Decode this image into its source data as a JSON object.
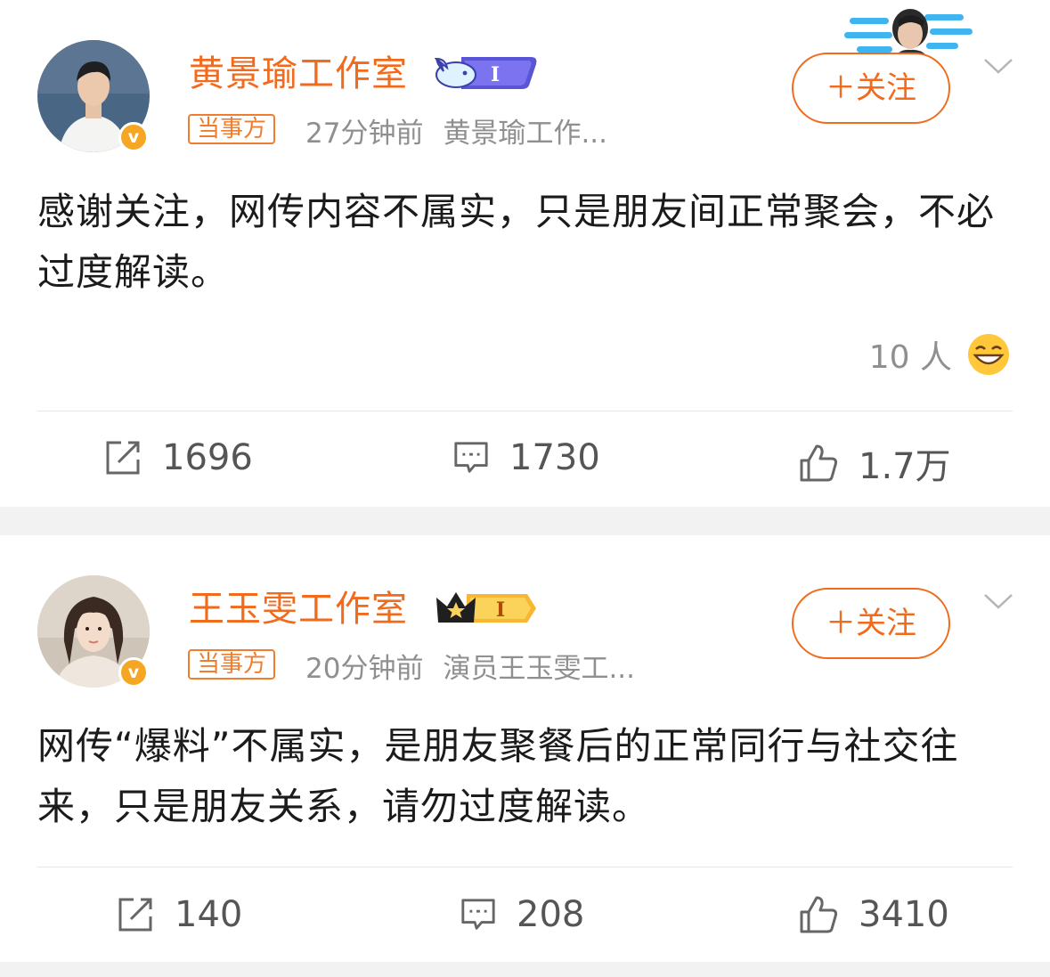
{
  "posts": [
    {
      "account_name": "黄景瑜工作室",
      "badge_text": "I",
      "tag": "当事方",
      "time": "27分钟前",
      "source": "黄景瑜工作...",
      "follow_label": "＋关注",
      "verified_mark": "v",
      "content": "感谢关注，网传内容不属实，只是朋友间正常聚会，不必过度解读。",
      "reaction_count": "10 人",
      "actions": {
        "repost": "1696",
        "comment": "1730",
        "like": "1.7万"
      }
    },
    {
      "account_name": "王玉雯工作室",
      "badge_text": "I",
      "tag": "当事方",
      "time": "20分钟前",
      "source": "演员王玉雯工...",
      "follow_label": "＋关注",
      "verified_mark": "v",
      "content": "网传“爆料”不属实，是朋友聚餐后的正常同行与社交往来，只是朋友关系，请勿过度解读。",
      "actions": {
        "repost": "140",
        "comment": "208",
        "like": "3410"
      }
    }
  ],
  "colors": {
    "accent": "#f26a1b",
    "verified": "#f5a623",
    "muted": "#8f8f8f",
    "text": "#1b1b1b",
    "separator": "#f2f2f2"
  },
  "icons": [
    "repost-icon",
    "comment-icon",
    "like-icon",
    "chevron-down-icon",
    "laughing-emoji-icon",
    "whale-member-badge-icon",
    "crown-member-badge-icon",
    "profile-card-decoration-icon"
  ]
}
